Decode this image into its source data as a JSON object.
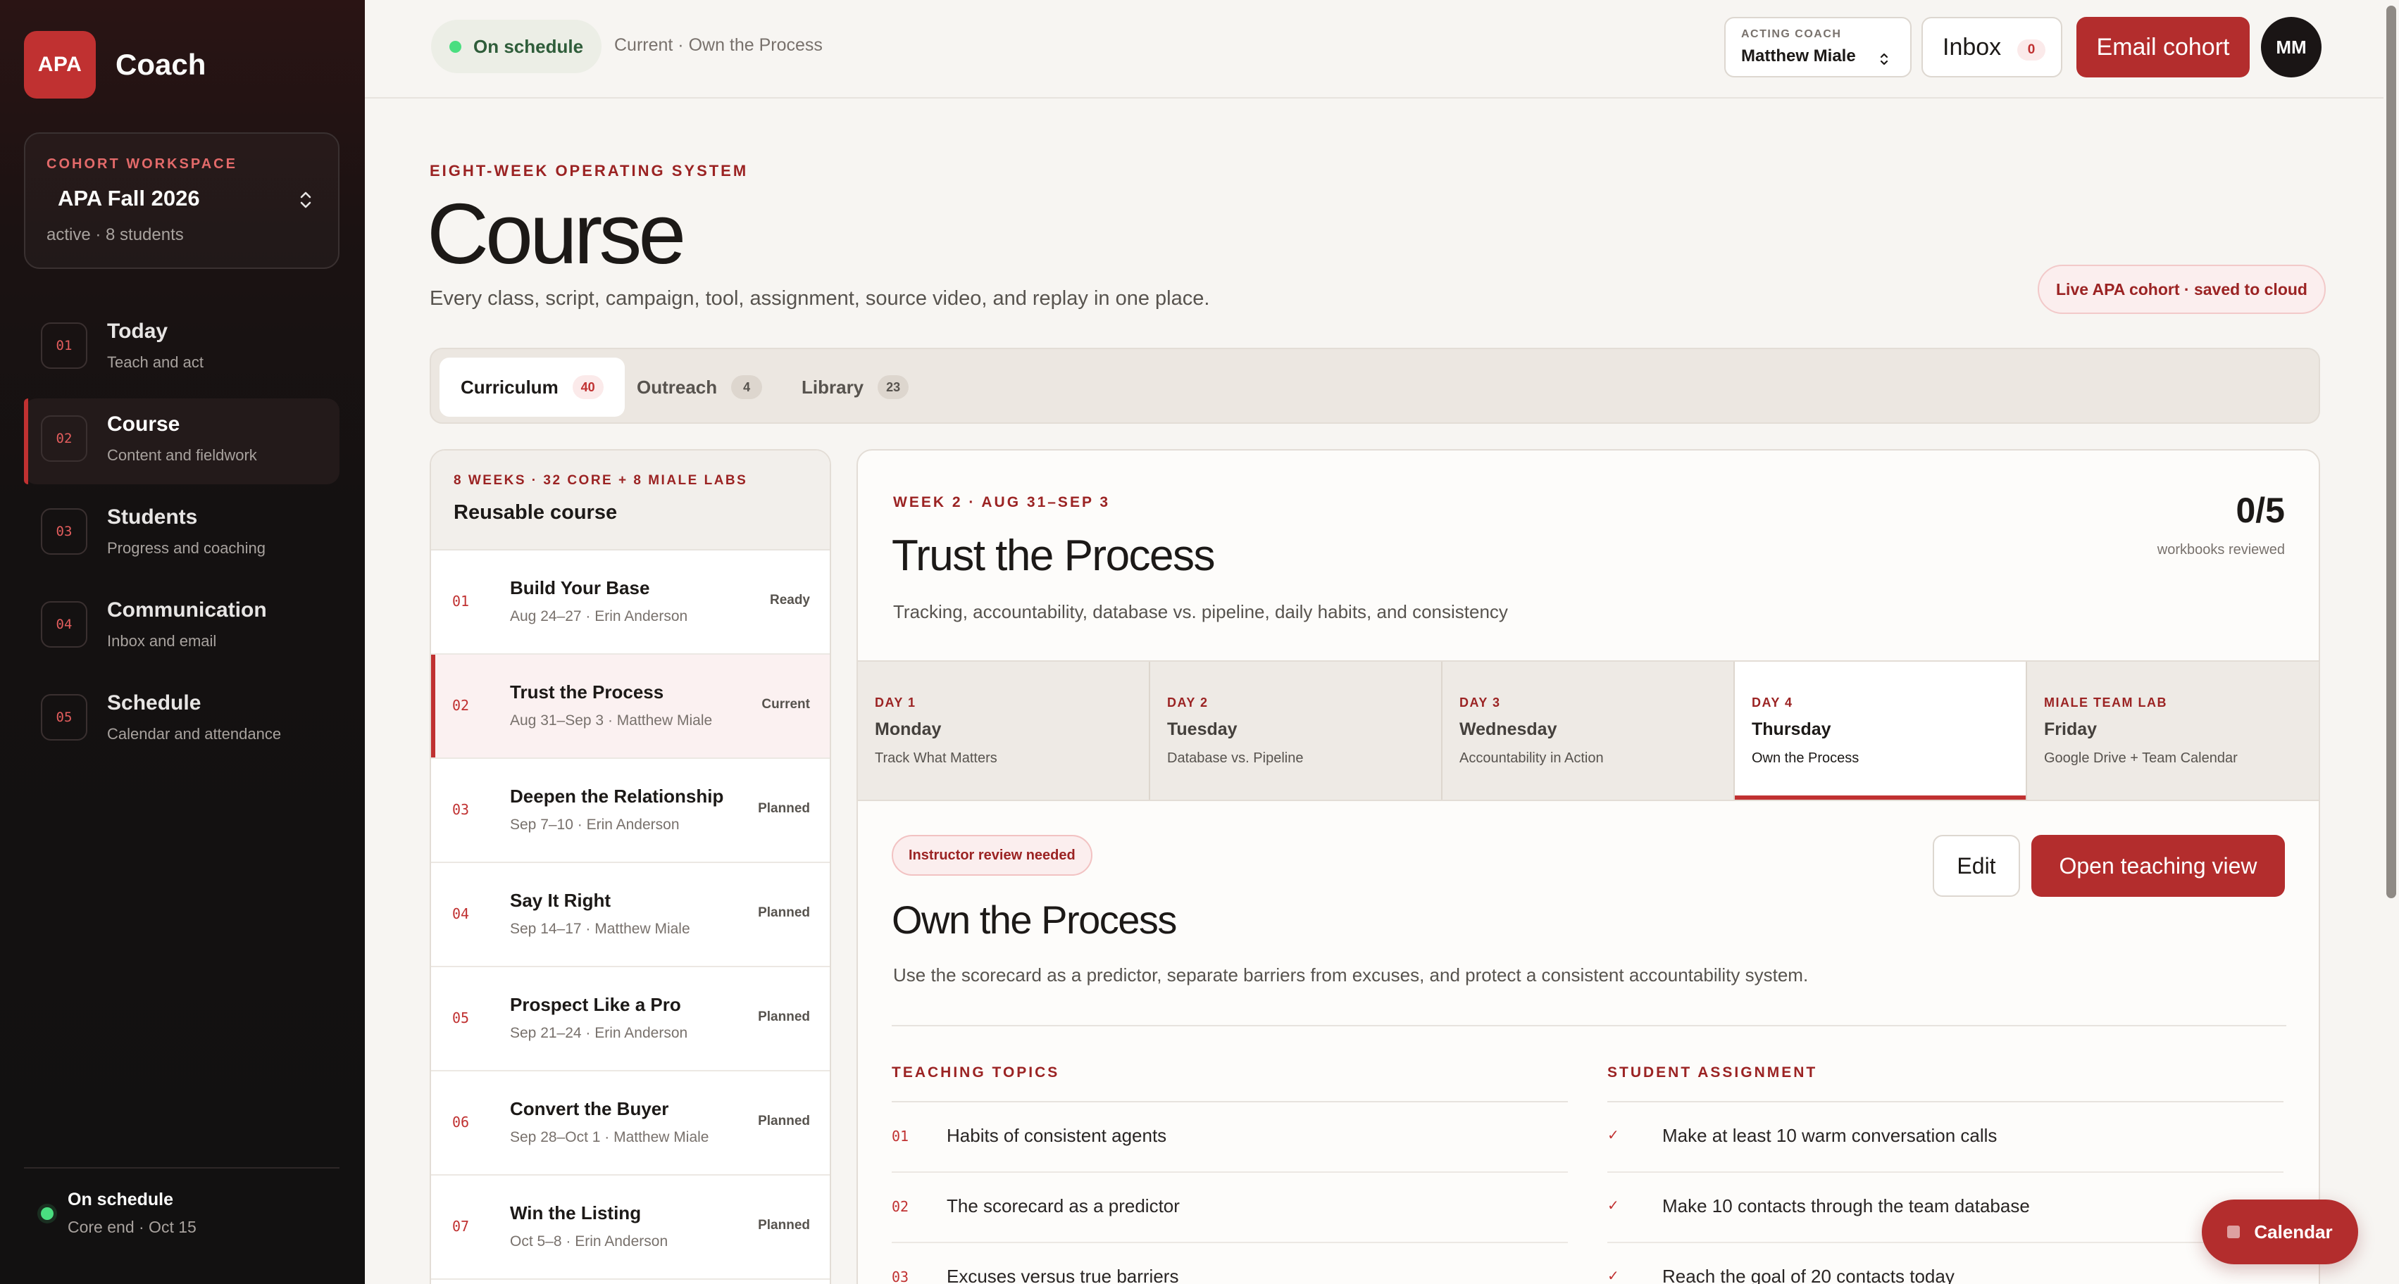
{
  "sidebar": {
    "brand_logo": "APA",
    "brand_name": "Coach",
    "workspace": {
      "label": "COHORT WORKSPACE",
      "name": "APA Fall 2026",
      "meta": "active · 8 students"
    },
    "nav": [
      {
        "num": "01",
        "title": "Today",
        "sub": "Teach and act"
      },
      {
        "num": "02",
        "title": "Course",
        "sub": "Content and fieldwork"
      },
      {
        "num": "03",
        "title": "Students",
        "sub": "Progress and coaching"
      },
      {
        "num": "04",
        "title": "Communication",
        "sub": "Inbox and email"
      },
      {
        "num": "05",
        "title": "Schedule",
        "sub": "Calendar and attendance"
      }
    ],
    "status": {
      "title": "On schedule",
      "sub": "Core end · Oct 15"
    }
  },
  "topbar": {
    "status": "On schedule",
    "crumb": "Current · Own the Process",
    "acting_label": "ACTING COACH",
    "acting_name": "Matthew Miale",
    "inbox_label": "Inbox",
    "inbox_count": "0",
    "email_label": "Email cohort",
    "avatar": "MM"
  },
  "header": {
    "eyebrow": "EIGHT-WEEK OPERATING SYSTEM",
    "title": "Course",
    "desc": "Every class, script, campaign, tool, assignment, source video, and replay in one place.",
    "live": "Live APA cohort · saved to cloud"
  },
  "tabs": [
    {
      "label": "Curriculum",
      "count": "40"
    },
    {
      "label": "Outreach",
      "count": "4"
    },
    {
      "label": "Library",
      "count": "23"
    }
  ],
  "course_list": {
    "eyebrow": "8 WEEKS · 32 CORE + 8 MIALE LABS",
    "title": "Reusable course",
    "rows": [
      {
        "num": "01",
        "title": "Build Your Base",
        "meta": "Aug 24–27 · Erin Anderson",
        "status": "Ready"
      },
      {
        "num": "02",
        "title": "Trust the Process",
        "meta": "Aug 31–Sep 3 · Matthew Miale",
        "status": "Current"
      },
      {
        "num": "03",
        "title": "Deepen the Relationship",
        "meta": "Sep 7–10 · Erin Anderson",
        "status": "Planned"
      },
      {
        "num": "04",
        "title": "Say It Right",
        "meta": "Sep 14–17 · Matthew Miale",
        "status": "Planned"
      },
      {
        "num": "05",
        "title": "Prospect Like a Pro",
        "meta": "Sep 21–24 · Erin Anderson",
        "status": "Planned"
      },
      {
        "num": "06",
        "title": "Convert the Buyer",
        "meta": "Sep 28–Oct 1 · Matthew Miale",
        "status": "Planned"
      },
      {
        "num": "07",
        "title": "Win the Listing",
        "meta": "Oct 5–8 · Erin Anderson",
        "status": "Planned"
      }
    ]
  },
  "week": {
    "eyebrow": "WEEK 2 · AUG 31–SEP 3",
    "title": "Trust the Process",
    "desc": "Tracking, accountability, database vs. pipeline, daily habits, and consistency",
    "count": "0/5",
    "count_label": "workbooks reviewed",
    "days": [
      {
        "label": "DAY 1",
        "name": "Monday",
        "sub": "Track What Matters"
      },
      {
        "label": "DAY 2",
        "name": "Tuesday",
        "sub": "Database vs. Pipeline"
      },
      {
        "label": "DAY 3",
        "name": "Wednesday",
        "sub": "Accountability in Action"
      },
      {
        "label": "DAY 4",
        "name": "Thursday",
        "sub": "Own the Process"
      },
      {
        "label": "MIALE TEAM LAB",
        "name": "Friday",
        "sub": "Google Drive + Team Calendar"
      }
    ]
  },
  "lesson": {
    "review": "Instructor review needed",
    "edit_label": "Edit",
    "open_label": "Open teaching view",
    "title": "Own the Process",
    "desc": "Use the scorecard as a predictor, separate barriers from excuses, and protect a consistent accountability system.",
    "topics_head": "TEACHING TOPICS",
    "topics": [
      {
        "num": "01",
        "text": "Habits of consistent agents"
      },
      {
        "num": "02",
        "text": "The scorecard as a predictor"
      },
      {
        "num": "03",
        "text": "Excuses versus true barriers"
      }
    ],
    "assign_head": "STUDENT ASSIGNMENT",
    "check_glyph": "✓",
    "assignments": [
      {
        "text": "Make at least 10 warm conversation calls"
      },
      {
        "text": "Make 10 contacts through the team database"
      },
      {
        "text": "Reach the goal of 20 contacts today"
      }
    ]
  },
  "calendar_fab": "Calendar",
  "colors": {
    "accent": "#b32d2d",
    "accent_text": "#9b2323",
    "success": "#4ade80",
    "sidebar_bg": "#141111"
  }
}
